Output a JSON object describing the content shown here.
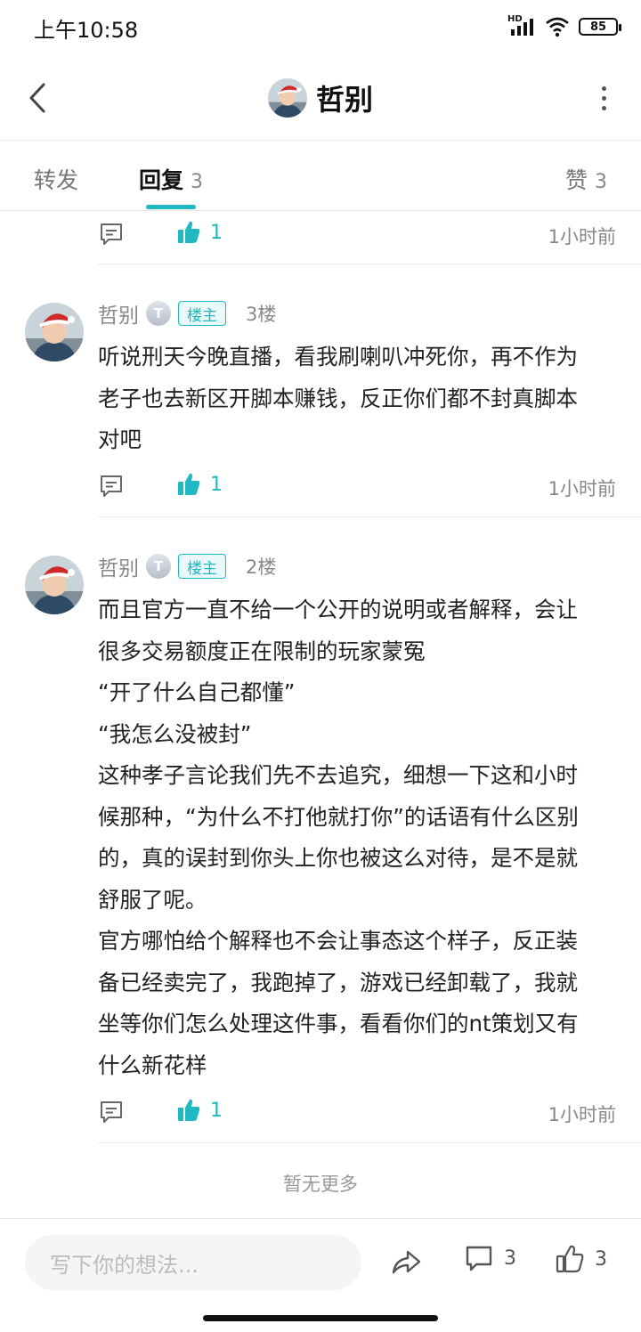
{
  "status_bar": {
    "time": "上午10:58",
    "network_label": "HD",
    "battery": "85"
  },
  "header": {
    "title": "哲别",
    "back_icon": "chevron-left-icon",
    "more_icon": "more-vertical-icon"
  },
  "tabs": [
    {
      "label": "转发",
      "count": ""
    },
    {
      "label": "回复",
      "count": "3"
    },
    {
      "label": "赞",
      "count": "3"
    }
  ],
  "accent_color": "#1fb8c3",
  "top_action_row": {
    "like_count": "1",
    "time": "1小时前"
  },
  "comments": [
    {
      "author": "哲别",
      "level_badge": "T",
      "owner_badge": "楼主",
      "floor": "3楼",
      "lines": [
        "听说刑天今晚直播，看我刷喇叭冲死你，再不作为",
        "老子也去新区开脚本赚钱，反正你们都不封真脚本",
        "对吧"
      ],
      "like_count": "1",
      "time": "1小时前"
    },
    {
      "author": "哲别",
      "level_badge": "T",
      "owner_badge": "楼主",
      "floor": "2楼",
      "lines": [
        "而且官方一直不给一个公开的说明或者解释，会让",
        "很多交易额度正在限制的玩家蒙冤",
        "“开了什么自己都懂”",
        "“我怎么没被封”",
        "这种孝子言论我们先不去追究，细想一下这和小时",
        "候那种，“为什么不打他就打你”的话语有什么区别",
        "的，真的误封到你头上你也被这么对待，是不是就",
        "舒服了呢。",
        "官方哪怕给个解释也不会让事态这个样子，反正装",
        "备已经卖完了，我跑掉了，游戏已经卸载了，我就",
        "坐等你们怎么处理这件事，看看你们的nt策划又有",
        "什么新花样"
      ],
      "like_count": "1",
      "time": "1小时前"
    }
  ],
  "no_more_text": "暂无更多",
  "bottom_bar": {
    "input_placeholder": "写下你的想法...",
    "comment_count": "3",
    "like_count": "3"
  }
}
